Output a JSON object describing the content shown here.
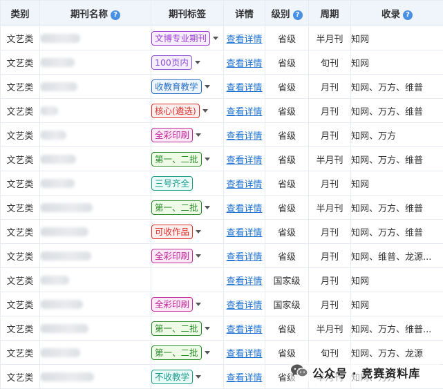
{
  "table": {
    "headers": {
      "category": "类别",
      "name": "期刊名称",
      "tag": "期刊标签",
      "detail": "详情",
      "level": "级别",
      "period": "周期",
      "index": "收录"
    },
    "help_icon_glyph": "?",
    "rows": [
      {
        "category": "文艺类",
        "tag": {
          "label": "文博专业期刊",
          "color": "#9b3bd3",
          "bg": "#f7eefd",
          "dropdown": true
        },
        "detail": "查看详情",
        "level": "省级",
        "period": "半月刊",
        "index": "知网"
      },
      {
        "category": "文艺类",
        "tag": {
          "label": "100页内",
          "color": "#8a4fd1",
          "bg": "#f4eefd",
          "dropdown": true
        },
        "detail": "查看详情",
        "level": "省级",
        "period": "旬刊",
        "index": "知网"
      },
      {
        "category": "文艺类",
        "tag": {
          "label": "收教育教学",
          "color": "#2a6fc4",
          "bg": "#eef5fd",
          "dropdown": true
        },
        "detail": "查看详情",
        "level": "省级",
        "period": "月刊",
        "index": "知网、万方、维普"
      },
      {
        "category": "文艺类",
        "tag": {
          "label": "核心(遴选)",
          "color": "#d9302a",
          "bg": "#fdeeee",
          "dropdown": true
        },
        "detail": "查看详情",
        "level": "省级",
        "period": "月刊",
        "index": "知网、万方、维普"
      },
      {
        "category": "文艺类",
        "tag": {
          "label": "全彩印刷",
          "color": "#c12a9a",
          "bg": "#fbe9f6",
          "dropdown": true
        },
        "detail": "查看详情",
        "level": "省级",
        "period": "月刊",
        "index": "知网、万方"
      },
      {
        "category": "文艺类",
        "tag": {
          "label": "第一、二批",
          "color": "#2a8a2a",
          "bg": "#eefbe6",
          "dropdown": true
        },
        "detail": "查看详情",
        "level": "省级",
        "period": "半月刊",
        "index": "知网、万方、维普"
      },
      {
        "category": "文艺类",
        "tag": {
          "label": "三号齐全",
          "color": "#1a9c8c",
          "bg": "#eafaf7",
          "dropdown": false
        },
        "detail": "查看详情",
        "level": "省级",
        "period": "月刊",
        "index": "知网"
      },
      {
        "category": "文艺类",
        "tag": {
          "label": "第一、二批",
          "color": "#2a8a2a",
          "bg": "#eefbe6",
          "dropdown": true
        },
        "detail": "查看详情",
        "level": "省级",
        "period": "半月刊",
        "index": "知网、万方、维普"
      },
      {
        "category": "文艺类",
        "tag": {
          "label": "可收作品",
          "color": "#d9302a",
          "bg": "#fdeeee",
          "dropdown": true
        },
        "detail": "查看详情",
        "level": "省级",
        "period": "月刊",
        "index": "知网、万方、维普"
      },
      {
        "category": "文艺类",
        "tag": {
          "label": "全彩印刷",
          "color": "#c12a9a",
          "bg": "#fbe9f6",
          "dropdown": true
        },
        "detail": "查看详情",
        "level": "省级",
        "period": "月刊",
        "index": "知网、维普、龙源..."
      },
      {
        "category": "文艺类",
        "tag": null,
        "detail": "查看详情",
        "level": "国家级",
        "period": "月刊",
        "index": "知网"
      },
      {
        "category": "文艺类",
        "tag": {
          "label": "全彩印刷",
          "color": "#c12a9a",
          "bg": "#fbe9f6",
          "dropdown": true
        },
        "detail": "查看详情",
        "level": "国家级",
        "period": "月刊",
        "index": "知网"
      },
      {
        "category": "文艺类",
        "tag": {
          "label": "第一、二批",
          "color": "#2a8a2a",
          "bg": "#eefbe6",
          "dropdown": true
        },
        "detail": "查看详情",
        "level": "省级",
        "period": "半月刊",
        "index": "知网、万方、维普..."
      },
      {
        "category": "文艺类",
        "tag": {
          "label": "第一、二批",
          "color": "#2a8a2a",
          "bg": "#eefbe6",
          "dropdown": true
        },
        "detail": "查看详情",
        "level": "省级",
        "period": "旬刊",
        "index": "知网、万方、龙源"
      },
      {
        "category": "文艺类",
        "tag": {
          "label": "不收教学",
          "color": "#1a9c8c",
          "bg": "#eafaf7",
          "dropdown": true
        },
        "detail": "查看详情",
        "level": "省级",
        "period": "半月刊",
        "index": "知网、万方"
      }
    ]
  },
  "watermark": {
    "text": "公众号 · 竞赛资料库",
    "icon": "wechat-logo-icon"
  }
}
